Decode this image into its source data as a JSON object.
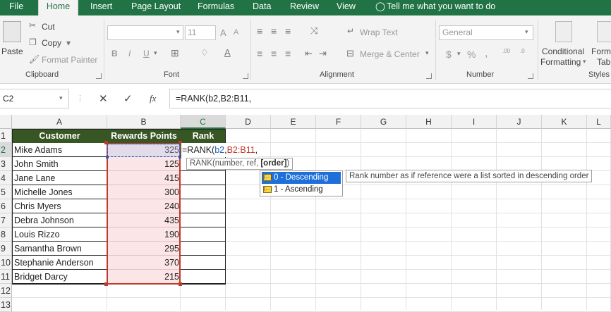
{
  "tabs": [
    "File",
    "Home",
    "Insert",
    "Page Layout",
    "Formulas",
    "Data",
    "Review",
    "View",
    "Tell me what you want to do"
  ],
  "clipboard": {
    "paste": "Paste",
    "cut": "Cut",
    "copy": "Copy",
    "painter": "Format Painter",
    "label": "Clipboard"
  },
  "font": {
    "size": "11",
    "bold": "B",
    "italic": "I",
    "underline": "U",
    "grow": "A",
    "shrink": "A",
    "label": "Font"
  },
  "alignment": {
    "wrap": "Wrap Text",
    "merge": "Merge & Center",
    "label": "Alignment"
  },
  "number": {
    "format": "General",
    "currency": "$",
    "percent": "%",
    "comma": ",",
    "inc": ".00",
    "dec": ".0",
    "label": "Number"
  },
  "styles": {
    "conditional": "Conditional",
    "formatting": "Formatting",
    "label": "Styles",
    "form": "Form",
    "table": "Tab"
  },
  "formula_bar": {
    "namebox": "C2",
    "cancel": "✕",
    "enter": "✓",
    "fx": "fx",
    "formula": "=RANK(b2,B2:B11,"
  },
  "columns": [
    "A",
    "B",
    "C",
    "D",
    "E",
    "F",
    "G",
    "H",
    "I",
    "J",
    "K",
    "L"
  ],
  "rows": [
    "1",
    "2",
    "3",
    "4",
    "5",
    "6",
    "7",
    "8",
    "9",
    "10",
    "11",
    "12",
    "13"
  ],
  "table": {
    "headers": [
      "Customer",
      "Rewards Points",
      "Rank"
    ],
    "rows": [
      {
        "name": "Mike Adams",
        "points": "325"
      },
      {
        "name": "John Smith",
        "points": "125"
      },
      {
        "name": "Jane Lane",
        "points": "415"
      },
      {
        "name": "Michelle Jones",
        "points": "300"
      },
      {
        "name": "Chris Myers",
        "points": "240"
      },
      {
        "name": "Debra Johnson",
        "points": "435"
      },
      {
        "name": "Louis Rizzo",
        "points": "190"
      },
      {
        "name": "Samantha Brown",
        "points": "295"
      },
      {
        "name": "Stephanie Anderson",
        "points": "370"
      },
      {
        "name": "Bridget Darcy",
        "points": "215"
      }
    ]
  },
  "edit": {
    "prefix": "=RANK(",
    "ref1": "b2",
    "comma1": ",",
    "ref2": "B2:B11",
    "comma2": ","
  },
  "tooltip": {
    "prefix": "RANK(number, ref, ",
    "bold": "[order]",
    "suffix": ")"
  },
  "autocomplete": [
    {
      "label": "0 - Descending",
      "highlighted": true
    },
    {
      "label": "1 - Ascending",
      "highlighted": false
    }
  ],
  "autocomplete_desc": "Rank number as if reference were a list sorted in descending order",
  "colors": {
    "excel_green": "#217346",
    "header_fill": "#375623",
    "range_fill": "#fbe5e6",
    "ref_blue": "#1f5fbf",
    "ref_red": "#c0392b"
  }
}
